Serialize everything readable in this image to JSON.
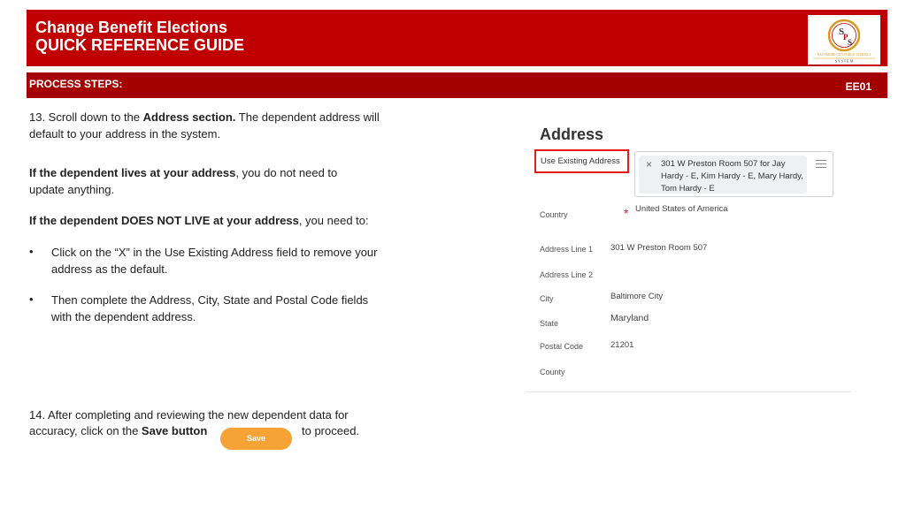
{
  "header": {
    "title_line1": "Change Benefit Elections",
    "title_line2": "QUICK REFERENCE GUIDE",
    "logo": {
      "initials": "SPS",
      "line1": "BALTIMORE CITY PUBLIC SCHOOLS",
      "line2": "S Y S T E M",
      "colors": {
        "gold": "#d99a1b",
        "red": "#c00000",
        "dark": "#333333"
      }
    }
  },
  "process_bar": {
    "label": "PROCESS STEPS:",
    "code": "EE01"
  },
  "steps": {
    "step13": {
      "prefix": "13.  Scroll down to the ",
      "bold": "Address section.",
      "suffix": "  The dependent address will default to your address in the system."
    },
    "lives": {
      "bold": "If the dependent lives at your address",
      "suffix": ", you do not need to update anything."
    },
    "not_lives": {
      "bold": "If the dependent DOES NOT LIVE at your address",
      "suffix": ", you need to:"
    },
    "bullets": [
      "Click on the “X” in the Use Existing Address field to remove your address as the default.",
      "Then complete the Address, City, State and Postal Code fields with the dependent address."
    ],
    "bullet_char": "•",
    "step14": {
      "line1": "14.  After completing and reviewing the new dependent data for",
      "prefix2": "accuracy, click on the ",
      "bold2": "Save button",
      "suffix2": "to proceed."
    },
    "save_label": "Save"
  },
  "address_panel": {
    "title": "Address",
    "use_existing_label": "Use Existing Address",
    "selected_value": "301 W Preston Room 507 for Jay Hardy - E, Kim Hardy - E, Mary Hardy, Tom Hardy - E",
    "remove_glyph": "×",
    "required_glyph": "*",
    "fields": [
      {
        "label": "Country",
        "value": "United States of America"
      },
      {
        "label": "Address Line 1",
        "value": "301 W Preston Room 507"
      },
      {
        "label": "Address Line 2",
        "value": ""
      },
      {
        "label": "City",
        "value": "Baltimore City"
      },
      {
        "label": "State",
        "value": "Maryland"
      },
      {
        "label": "Postal Code",
        "value": "21201"
      },
      {
        "label": "County",
        "value": ""
      }
    ]
  }
}
